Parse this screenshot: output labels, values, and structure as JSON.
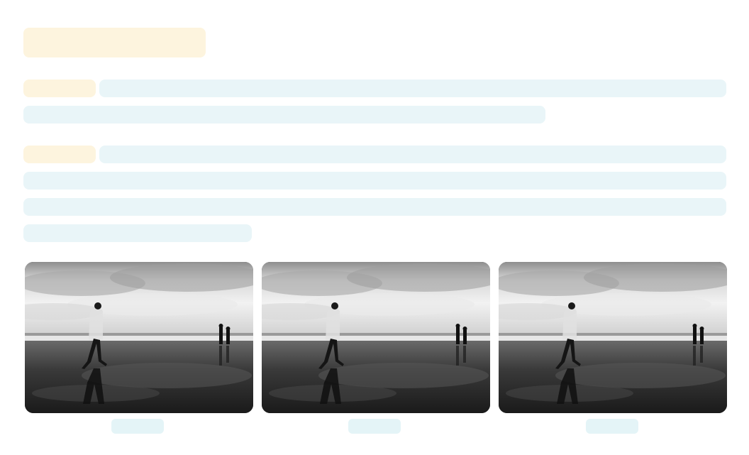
{
  "page": {
    "title_placeholder": "",
    "sections": [
      {
        "label_placeholder": "",
        "lines": [
          "",
          ""
        ]
      },
      {
        "label_placeholder": "",
        "lines": [
          "",
          "",
          "",
          ""
        ]
      }
    ]
  },
  "gallery": {
    "items": [
      {
        "image": "beach-walker-bw-photo",
        "caption": ""
      },
      {
        "image": "beach-walker-bw-photo",
        "caption": ""
      },
      {
        "image": "beach-walker-bw-photo",
        "caption": ""
      }
    ]
  },
  "colors": {
    "warm_placeholder": "#fdf4de",
    "cool_placeholder": "#e9f5f8",
    "caption_placeholder": "#e4f4f7"
  }
}
